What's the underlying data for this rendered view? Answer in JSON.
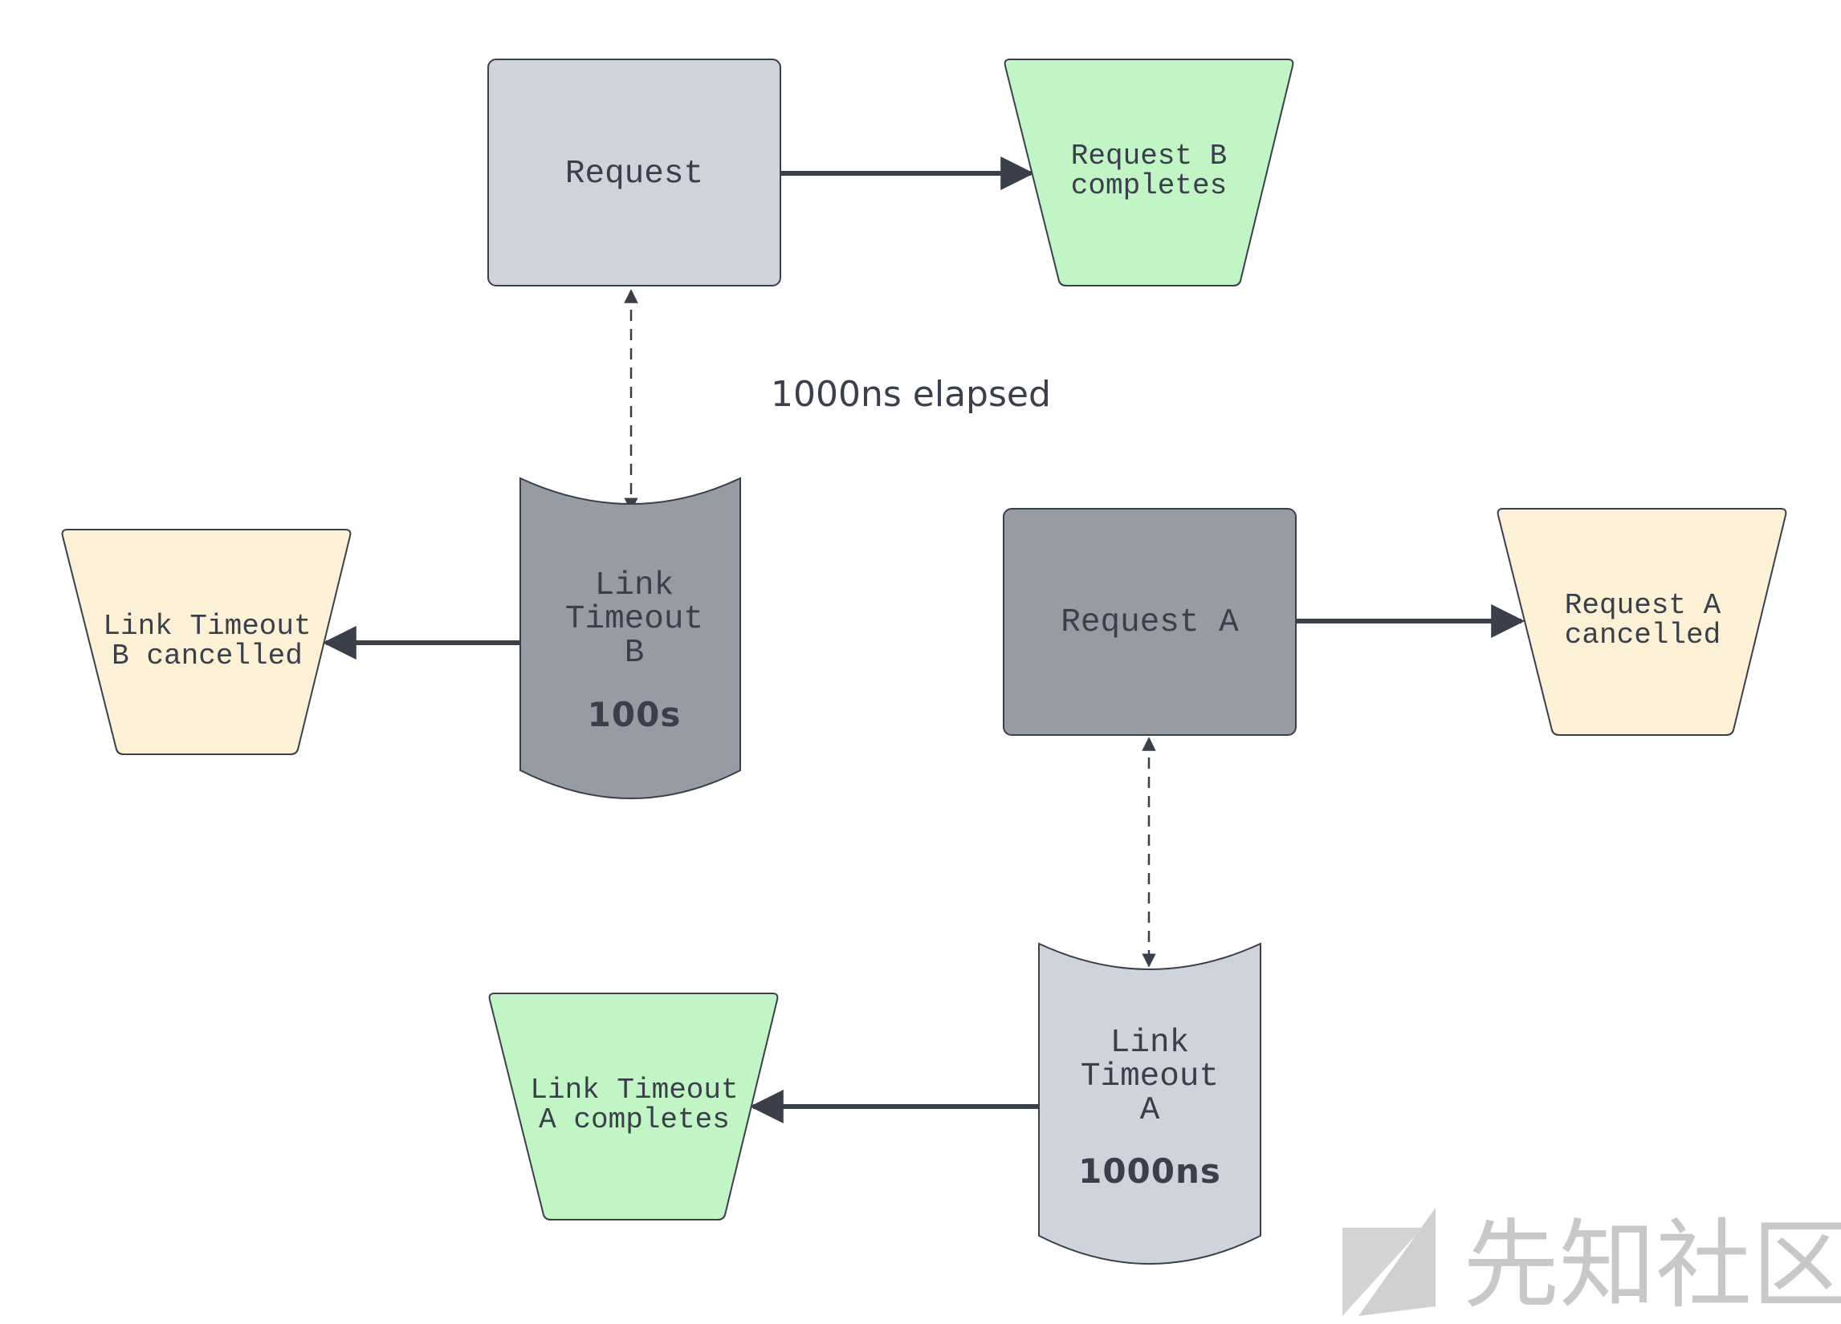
{
  "colors": {
    "grey_light": "#cfd3dc",
    "grey_dark": "#979ba3",
    "green": "#c2f5c6",
    "cream": "#fcf1d6",
    "stroke": "#3a3f4a"
  },
  "nodes": {
    "request_b": {
      "label": "Request"
    },
    "request_b_completes": {
      "line1": "Request B",
      "line2": "completes"
    },
    "link_timeout_b": {
      "line1": "Link",
      "line2": "Timeout",
      "line3": "B",
      "duration": "100s"
    },
    "link_timeout_b_cancelled": {
      "line1": "Link Timeout",
      "line2": "B cancelled"
    },
    "request_a": {
      "label": "Request A"
    },
    "request_a_cancelled": {
      "line1": "Request A",
      "line2": "cancelled"
    },
    "link_timeout_a": {
      "line1": "Link",
      "line2": "Timeout",
      "line3": "A",
      "duration": "1000ns"
    },
    "link_timeout_a_completes": {
      "line1": "Link Timeout",
      "line2": "A completes"
    }
  },
  "annotations": {
    "elapsed": "1000ns elapsed"
  },
  "watermark": {
    "text": "先知社区"
  }
}
